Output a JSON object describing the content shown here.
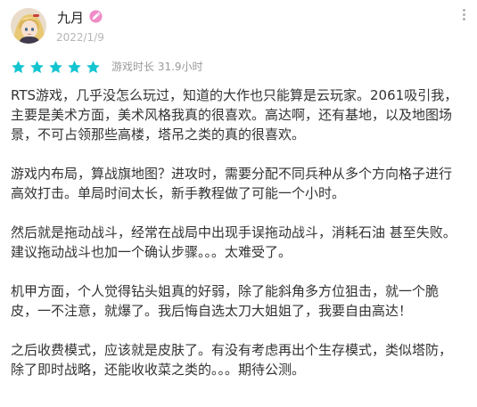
{
  "review": {
    "user_name": "九月",
    "date": "2022/1/9",
    "rating": 5,
    "rating_max": 5,
    "playtime": "游戏时长 31.9小时",
    "paragraphs": [
      "RTS游戏，几乎没怎么玩过，知道的大作也只能算是云玩家。2061吸引我，主要是美术方面，美术风格我真的很喜欢。高达啊，还有基地，以及地图场景，不可占领那些高楼，塔吊之类的真的很喜欢。",
      "游戏内布局，算战旗地图？进攻时，需要分配不同兵种从多个方向格子进行高效打击。单局时间太长，新手教程做了可能一个小时。",
      "然后就是拖动战斗，经常在战局中出现手误拖动战斗，消耗石油 甚至失败。建议拖动战斗也加一个确认步骤。。。太难受了。",
      "机甲方面，个人觉得钻头姐真的好弱，除了能斜角多方位狙击，就一个脆皮，一不注意，就爆了。我后悔自选太刀大姐姐了，我要自由高达！",
      "之后收费模式，应该就是皮肤了。有没有考虑再出个生存模式，类似塔防，除了即时战略，还能收收菜之类的。。。期待公测。"
    ]
  },
  "icons": {
    "avatar": "user-avatar-image",
    "badge": "verified-badge-icon",
    "star": "star-icon",
    "more": "more-vertical-icon"
  },
  "colors": {
    "star": "#14c5d0",
    "badge": "#f08bc8",
    "date": "#b6b6b6",
    "text": "#333333"
  }
}
